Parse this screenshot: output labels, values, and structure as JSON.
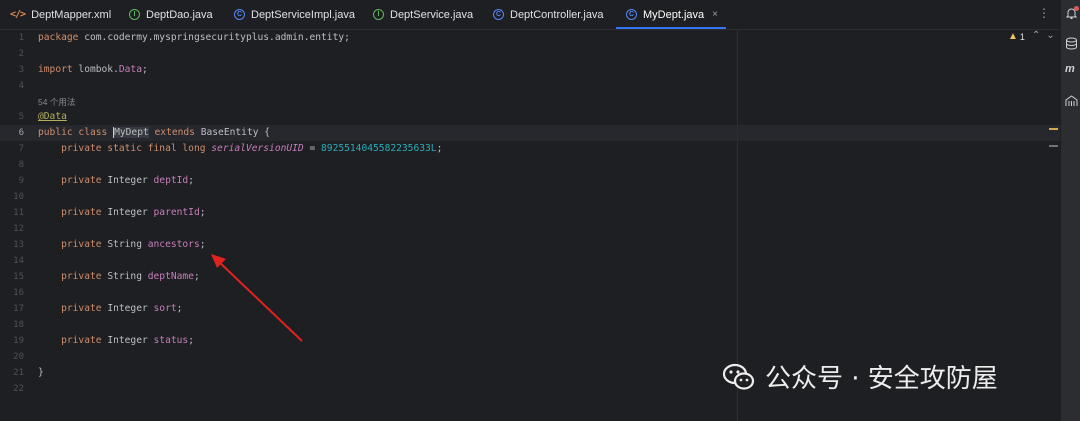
{
  "tabs": [
    {
      "label": "DeptMapper.xml",
      "icon": "xml-file-icon",
      "active": false
    },
    {
      "label": "DeptDao.java",
      "icon": "interface-icon",
      "active": false
    },
    {
      "label": "DeptServiceImpl.java",
      "icon": "class-icon",
      "active": false
    },
    {
      "label": "DeptService.java",
      "icon": "interface-icon",
      "active": false
    },
    {
      "label": "DeptController.java",
      "icon": "class-icon",
      "active": false
    },
    {
      "label": "MyDept.java",
      "icon": "class-icon",
      "active": true
    }
  ],
  "tab_close": "×",
  "tab_menu": "⋮",
  "editor": {
    "line_numbers": [
      "1",
      "2",
      "3",
      "4",
      "5",
      "6",
      "7",
      "8",
      "9",
      "10",
      "11",
      "12",
      "13",
      "14",
      "15",
      "16",
      "17",
      "18",
      "19",
      "20",
      "21",
      "22"
    ],
    "current_line": "6",
    "usages_hint": "54 个用法",
    "lines": {
      "l1_kw": "package",
      "l1_rest": " com.codermy.myspringsecurityplus.admin.entity;",
      "l3_kw": "import",
      "l3_rest": " lombok.",
      "l3_cls": "Data",
      "l3_end": ";",
      "l5_ann": "@Data",
      "l6_kw": "public class ",
      "l6_name": "MyDept",
      "l6_ext": " extends ",
      "l6_rest": "BaseEntity {",
      "l7_kw": "    private static final long ",
      "l7_field": "serialVersionUID",
      "l7_eq": " = ",
      "l7_num": "8925514045582235633L",
      "l7_end": ";",
      "l9_kw": "    private ",
      "l9_type": "Integer ",
      "l9_field": "deptId",
      "l11_kw": "    private ",
      "l11_type": "Integer ",
      "l11_field": "parentId",
      "l13_kw": "    private ",
      "l13_type": "String ",
      "l13_field": "ancestors",
      "l15_kw": "    private ",
      "l15_type": "String ",
      "l15_field": "deptName",
      "l17_kw": "    private ",
      "l17_type": "Integer ",
      "l17_field": "sort",
      "l19_kw": "    private ",
      "l19_type": "Integer ",
      "l19_field": "status",
      "semi": ";",
      "l21": "}"
    }
  },
  "inspection": {
    "warnings": "1",
    "icon": "warning-triangle-icon"
  },
  "nav_arrows": "⌃⌄",
  "watermark": {
    "text": "公众号 · 安全攻防屋",
    "icon": "wechat-logo"
  },
  "colors": {
    "accent": "#3574f0",
    "arrow": "#e0231c",
    "keyword": "#cf8e6d",
    "field": "#c77dbb",
    "number": "#2aacb8"
  }
}
